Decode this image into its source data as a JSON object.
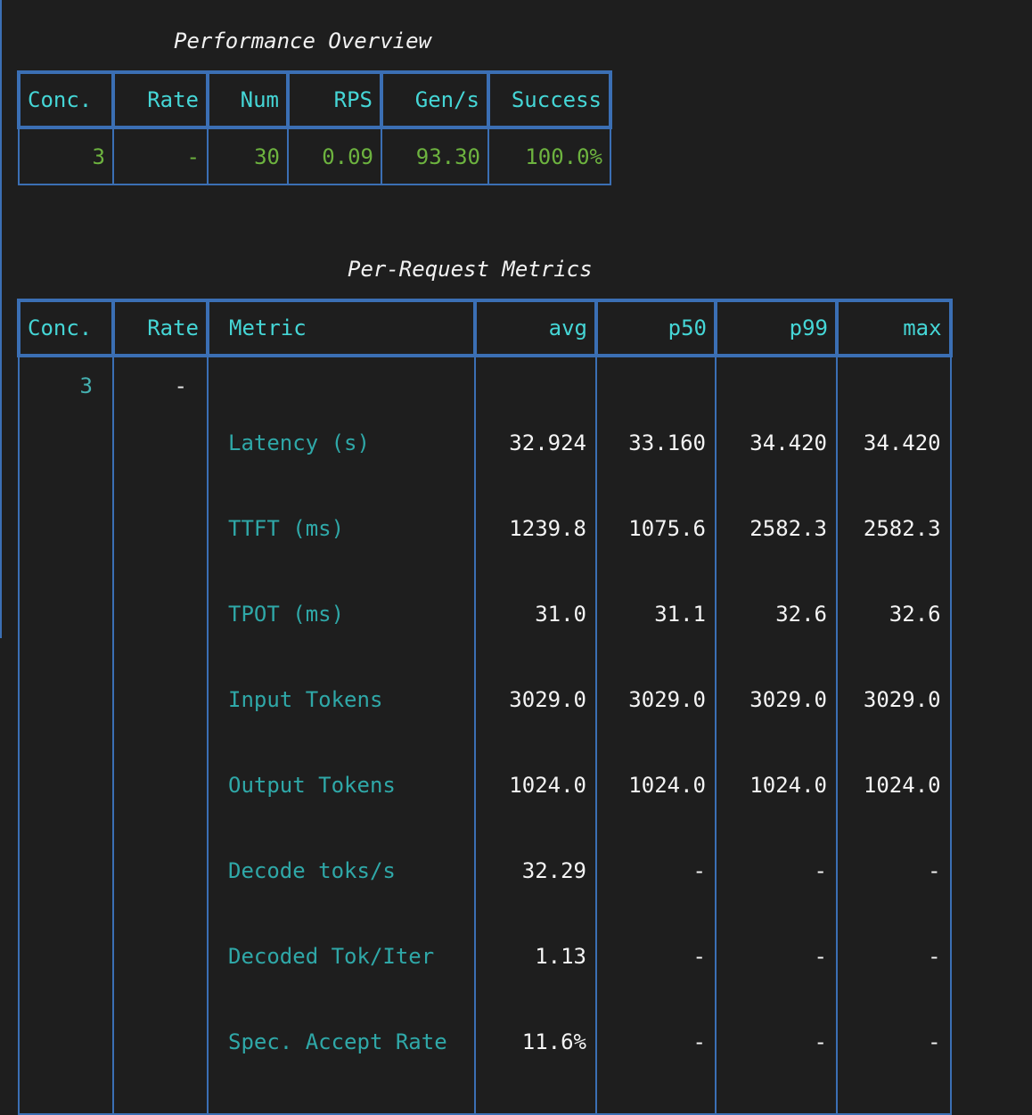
{
  "performance_overview": {
    "title": "Performance Overview",
    "headers": [
      "Conc.",
      "Rate",
      "Num",
      "RPS",
      "Gen/s",
      "Success"
    ],
    "row": [
      "3",
      "-",
      "30",
      "0.09",
      "93.30",
      "100.0%"
    ]
  },
  "per_request_metrics": {
    "title": "Per-Request Metrics",
    "headers": [
      "Conc.",
      "Rate",
      "Metric",
      "avg",
      "p50",
      "p99",
      "max"
    ],
    "conc": "3",
    "rate": "-",
    "metrics": [
      {
        "name": "Latency (s)",
        "avg": "32.924",
        "p50": "33.160",
        "p99": "34.420",
        "max": "34.420"
      },
      {
        "name": "TTFT (ms)",
        "avg": "1239.8",
        "p50": "1075.6",
        "p99": "2582.3",
        "max": "2582.3"
      },
      {
        "name": "TPOT (ms)",
        "avg": "31.0",
        "p50": "31.1",
        "p99": "32.6",
        "max": "32.6"
      },
      {
        "name": "Input Tokens",
        "avg": "3029.0",
        "p50": "3029.0",
        "p99": "3029.0",
        "max": "3029.0"
      },
      {
        "name": "Output Tokens",
        "avg": "1024.0",
        "p50": "1024.0",
        "p99": "1024.0",
        "max": "1024.0"
      },
      {
        "name": "Decode toks/s",
        "avg": "32.29",
        "p50": "-",
        "p99": "-",
        "max": "-"
      },
      {
        "name": "Decoded Tok/Iter",
        "avg": "1.13",
        "p50": "-",
        "p99": "-",
        "max": "-"
      },
      {
        "name": "Spec. Accept Rate",
        "avg": "11.6%",
        "p50": "-",
        "p99": "-",
        "max": "-"
      }
    ]
  },
  "colors": {
    "background": "#1e1e1e",
    "border": "#3b6fb4",
    "header_text": "#45d6d6",
    "overview_values": "#6db33f",
    "metric_names": "#2fa8a8"
  }
}
